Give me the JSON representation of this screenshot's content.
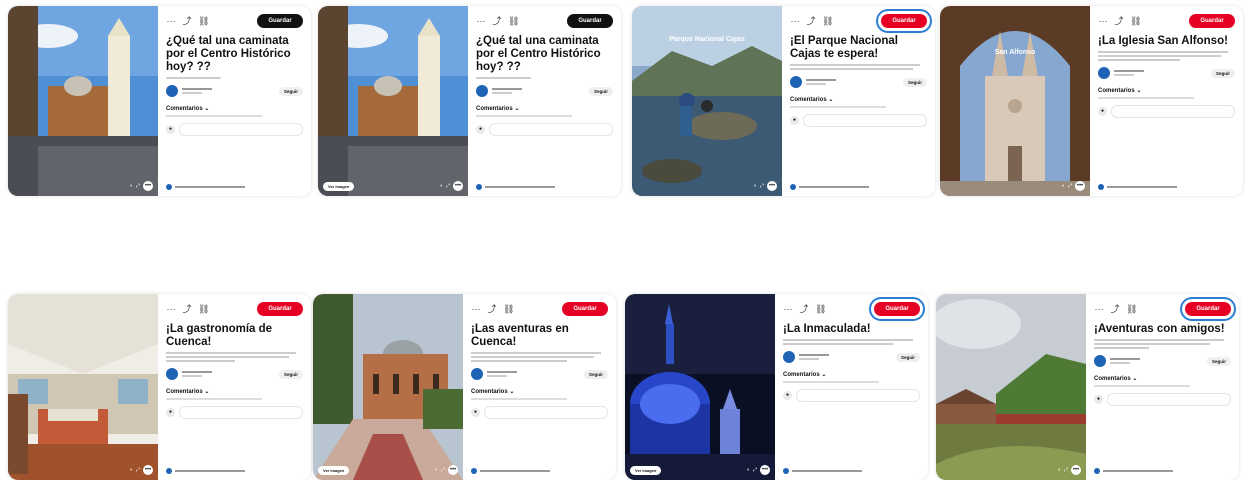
{
  "toolbar": {
    "more": "···",
    "share": "⤴",
    "link": "🔗"
  },
  "save_label": "Guardar",
  "comments_label": "Comentarios",
  "follow_label": "Seguir",
  "see_more_label": "Ver imagen",
  "cards": [
    {
      "title": "¿Qué tal una caminata por el Centro Histórico hoy? ??",
      "save_style": "dark"
    },
    {
      "title": "¿Qué tal una caminata por el Centro Histórico hoy? ??",
      "save_style": "dark"
    },
    {
      "title": "¡El Parque Nacional Cajas te espera!",
      "save_style": "red-ring",
      "image_text": "Parque Nacional Cajas"
    },
    {
      "title": "¡La Iglesia San Alfonso!",
      "save_style": "red",
      "image_text": "San Alfonso"
    },
    {
      "title": "¡La gastronomía de Cuenca!",
      "save_style": "red"
    },
    {
      "title": "¡Las aventuras en Cuenca!",
      "save_style": "red"
    },
    {
      "title": "¡La Inmaculada!",
      "save_style": "red-ring"
    },
    {
      "title": "¡Aventuras con amigos!",
      "save_style": "red-ring"
    }
  ],
  "colors": {
    "save_red": "#e60023",
    "save_dark": "#111111",
    "avatar_blue": "#1e63b5",
    "ring_blue": "#2d7dd2"
  }
}
